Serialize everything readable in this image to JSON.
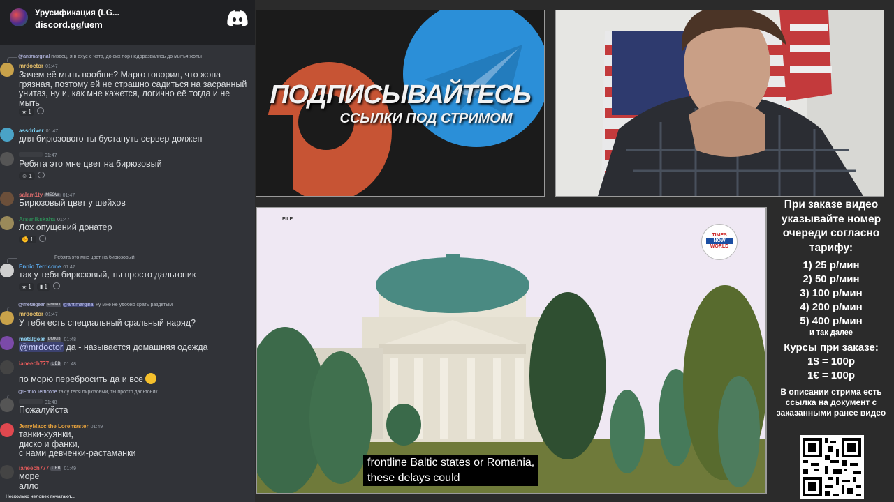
{
  "chat": {
    "server_name": "Урусификация (LG...",
    "server_link": "discord.gg/uem",
    "typing": "Несколько человек печатают...",
    "messages": [
      {
        "reply_user": "@antimarginal",
        "reply_text": "пиздец, я в ахуе с чата, до сих пор недоразвились до мытья жопы",
        "user": "mrdoctor",
        "time": "01:47",
        "user_color": "#e8c16b",
        "text": "Зачем её мыть вообще? Марго говорил, что жопа грязная, поэтому ей не страшно садиться на засранный унитаз, ну и, как мне кажется, логично её тогда и не мыть",
        "react": "1"
      },
      {
        "user": "assdriver",
        "time": "01:47",
        "user_color": "#7bd3f7",
        "text": "для бирюзового ты бустануть сервер должен"
      },
      {
        "user": "",
        "time": "01:47",
        "user_color": "#d85b5b",
        "text": "Ребята это мне цвет на бирюзовый",
        "react": "1"
      },
      {
        "user": "salam1ty",
        "tag": "MEOW",
        "time": "01:47",
        "user_color": "#e06d6d",
        "text": "Бирюзовый цвет у шейхов"
      },
      {
        "user": "Arsenikskaha",
        "time": "01:47",
        "user_color": "#2e8b57",
        "text": "Лох опущений донатер",
        "react": "1"
      },
      {
        "reply_user": "",
        "reply_text": "Ребята это мне цвет на бирюзовый",
        "user": "Ennio Terricone",
        "time": "01:47",
        "user_color": "#5aa7e8",
        "text": "так у тебя бирюзовый, ты просто дальтоник",
        "react": "1",
        "react2": "1"
      },
      {
        "reply_user": "@metalgear",
        "reply_tag": "PMND",
        "reply_mention": "@antimarginal",
        "reply_text": "ну мне не удобно срать раздетым",
        "user": "mrdoctor",
        "time": "01:47",
        "user_color": "#e8c16b",
        "text": "У тебя есть специальный сральный наряд?"
      },
      {
        "user": "metalgear",
        "tag": "PMND",
        "time": "01:48",
        "user_color": "#8fd3f4",
        "mention": "@mrdoctor",
        "text": " да - называется домашняя одежда"
      },
      {
        "user": "ianeech777",
        "tag": "UEB",
        "time": "01:48",
        "user_color": "#e05a5a",
        "text": "по морю перебросить да и все"
      },
      {
        "reply_user": "@Ennio Terricone",
        "reply_text": "так у тебя бирюзовый, ты просто дальтоник",
        "user": "",
        "time": "01:48",
        "user_color": "#d85b5b",
        "text": "Пожалуйста"
      },
      {
        "user": "JerryMacc the Loremaster",
        "time": "01:49",
        "user_color": "#e8a33d",
        "text": "танки-хуянки,\nдиско и фанки,\nс нами девченки-растаманки"
      },
      {
        "user": "ianeech777",
        "tag": "UEB",
        "time": "01:49",
        "user_color": "#e05a5a",
        "text": "море\nалло"
      }
    ]
  },
  "promo": {
    "title": "ПОДПИСЫВАЙТЕСЬ",
    "subtitle": "ССЫЛКИ ПОД СТРИМОМ"
  },
  "news": {
    "file_tag": "FILE",
    "logo_top": "TIMES",
    "logo_mid": "NOW",
    "logo_bot": "WORLD",
    "caption_line1": "frontline Baltic states or Romania,",
    "caption_line2": "these delays could"
  },
  "info": {
    "header": "При заказе видео указывайте номер очереди согласно тарифу:",
    "tariffs": [
      "1) 25 р/мин",
      "2) 50 р/мин",
      "3) 100 р/мин",
      "4) 200 р/мин",
      "5) 400 р/мин"
    ],
    "etc": "и так далее",
    "rates_title": "Курсы при заказе:",
    "rate1": "1$ = 100р",
    "rate2": "1€ = 100р",
    "desc": "В описании стрима есть ссылка на документ с заказанными ранее видео"
  }
}
